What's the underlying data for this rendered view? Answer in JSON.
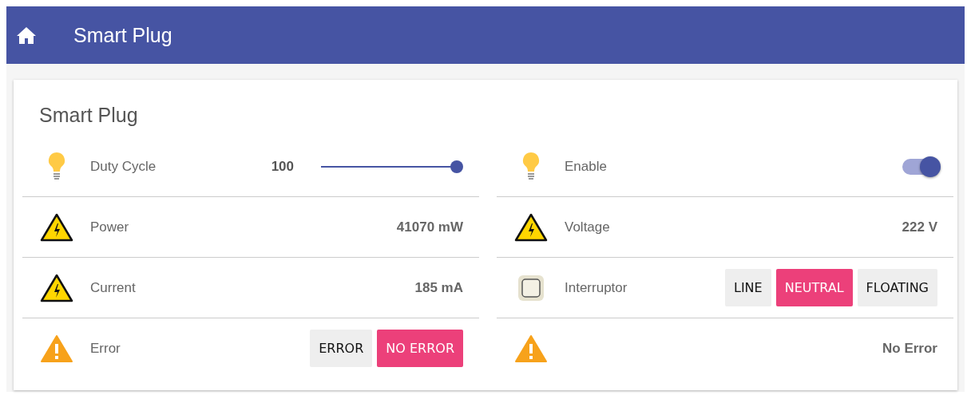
{
  "app_bar": {
    "title": "Smart Plug"
  },
  "card": {
    "title": "Smart Plug",
    "columns": [
      [
        {
          "kind": "slider",
          "label": "Duty Cycle",
          "value": "100",
          "level": 1
        },
        {
          "kind": "value",
          "label": "Power",
          "value": "41070 mW"
        },
        {
          "kind": "value",
          "label": "Current",
          "value": "185 mA"
        },
        {
          "kind": "buttons",
          "label": "Error",
          "options": [
            {
              "label": "ERROR",
              "selected": false
            },
            {
              "label": "NO ERROR",
              "selected": true
            }
          ]
        }
      ],
      [
        {
          "kind": "toggle",
          "label": "Enable",
          "on": true
        },
        {
          "kind": "value",
          "label": "Voltage",
          "value": "222 V"
        },
        {
          "kind": "buttons",
          "label": "Interruptor",
          "options": [
            {
              "label": "LINE",
              "selected": false
            },
            {
              "label": "NEUTRAL",
              "selected": true
            },
            {
              "label": "FLOATING",
              "selected": false
            }
          ]
        },
        {
          "kind": "value",
          "value": "No Error"
        }
      ]
    ]
  }
}
